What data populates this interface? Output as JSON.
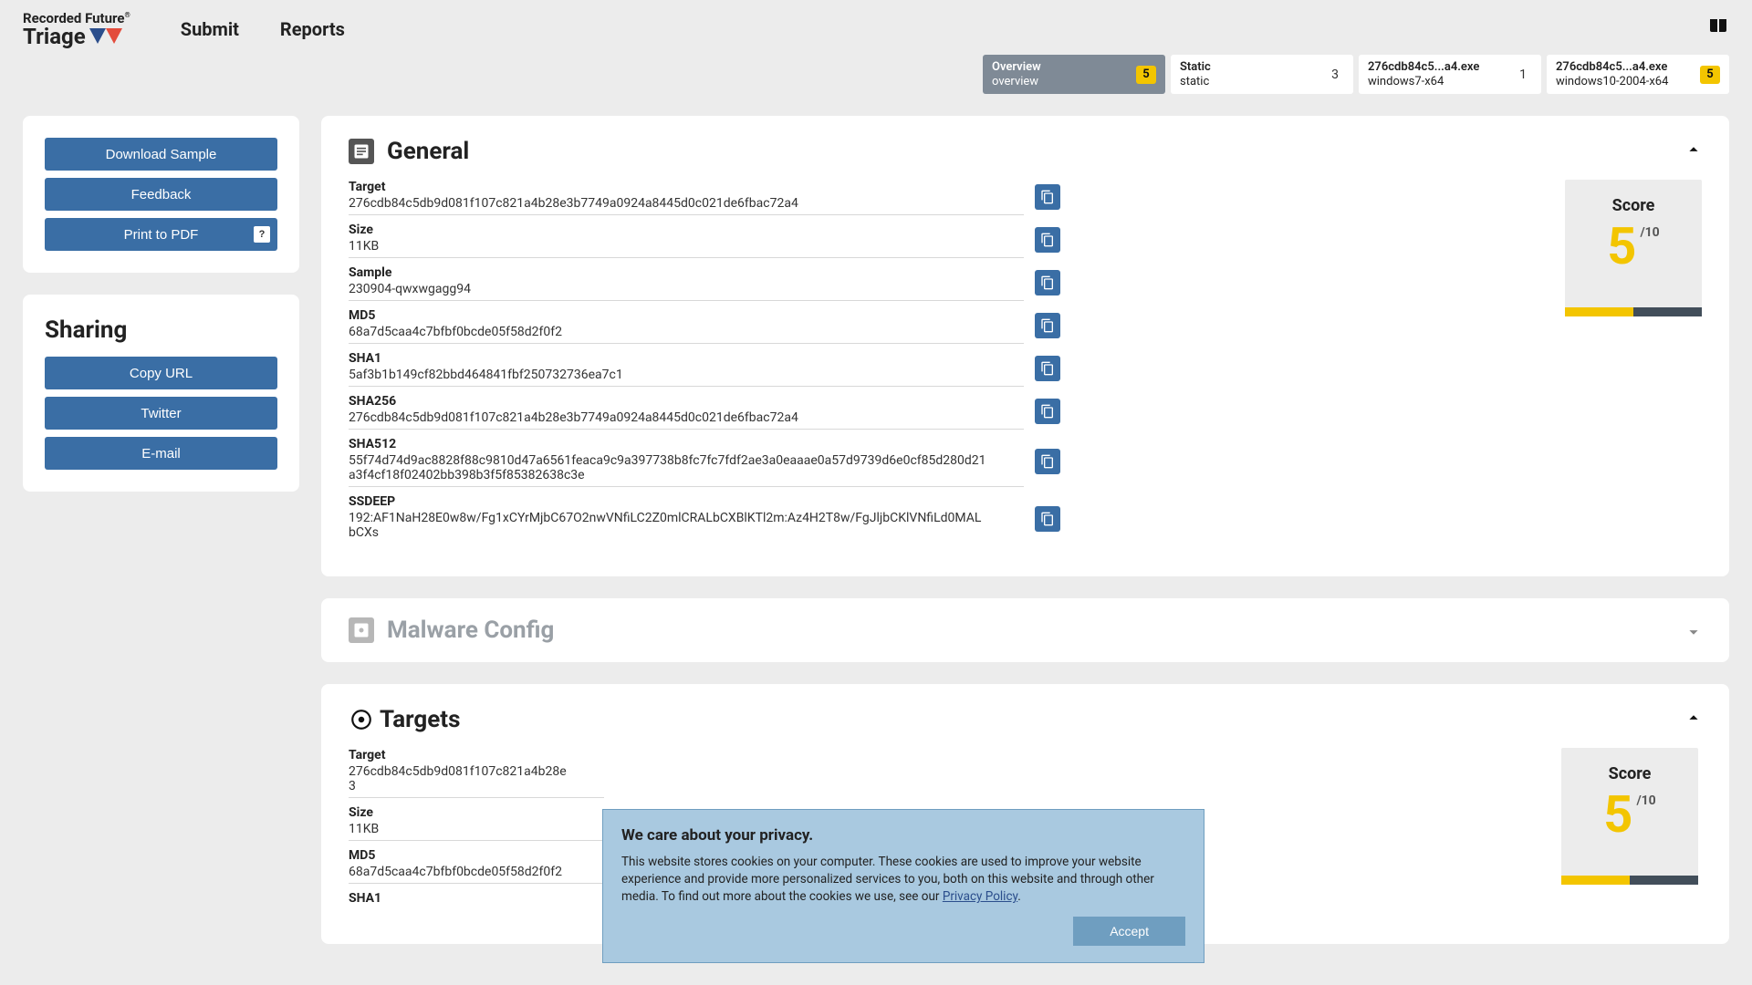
{
  "brand": {
    "line1": "Recorded Future",
    "line2": "Triage"
  },
  "nav": {
    "submit": "Submit",
    "reports": "Reports"
  },
  "tabs": [
    {
      "title": "Overview",
      "sub": "overview",
      "badge": 5,
      "badgeType": "score",
      "active": true
    },
    {
      "title": "Static",
      "sub": "static",
      "badge": 3,
      "badgeType": "plain",
      "active": false
    },
    {
      "title": "276cdb84c5...a4.exe",
      "sub": "windows7-x64",
      "badge": 1,
      "badgeType": "plain",
      "active": false
    },
    {
      "title": "276cdb84c5...a4.exe",
      "sub": "windows10-2004-x64",
      "badge": 5,
      "badgeType": "score",
      "active": false
    }
  ],
  "sidebar": {
    "download": "Download Sample",
    "feedback": "Feedback",
    "print": "Print to PDF",
    "print_key": "?",
    "sharing_title": "Sharing",
    "copy_url": "Copy URL",
    "twitter": "Twitter",
    "email": "E-mail"
  },
  "general": {
    "title": "General",
    "score_label": "Score",
    "score": "5",
    "score_max": "/10",
    "fields": {
      "target_l": "Target",
      "target": "276cdb84c5db9d081f107c821a4b28e3b7749a0924a8445d0c021de6fbac72a4",
      "size_l": "Size",
      "size": "11KB",
      "sample_l": "Sample",
      "sample": "230904-qwxwgagg94",
      "md5_l": "MD5",
      "md5": "68a7d5caa4c7bfbf0bcde05f58d2f0f2",
      "sha1_l": "SHA1",
      "sha1": "5af3b1b149cf82bbd464841fbf250732736ea7c1",
      "sha256_l": "SHA256",
      "sha256": "276cdb84c5db9d081f107c821a4b28e3b7749a0924a8445d0c021de6fbac72a4",
      "sha512_l": "SHA512",
      "sha512": "55f74d74d9ac8828f88c9810d47a6561feaca9c9a397738b8fc7fc7fdf2ae3a0eaaae0a57d9739d6e0cf85d280d21a3f4cf18f02402bb398b3f5f85382638c3e",
      "ssdeep_l": "SSDEEP",
      "ssdeep": "192:AF1NaH28E0w8w/Fg1xCYrMjbC67O2nwVNfiLC2Z0mlCRALbCXBlKTl2m:Az4H2T8w/FgJljbCKlVNfiLd0MALbCXs"
    }
  },
  "malware_config": {
    "title": "Malware Config"
  },
  "targets": {
    "title": "Targets",
    "score_label": "Score",
    "score": "5",
    "score_max": "/10",
    "fields": {
      "target_l": "Target",
      "target": "276cdb84c5db9d081f107c821a4b28e3",
      "size_l": "Size",
      "size": "11KB",
      "md5_l": "MD5",
      "md5": "68a7d5caa4c7bfbf0bcde05f58d2f0f2",
      "sha1_l": "SHA1"
    }
  },
  "cookie": {
    "title": "We care about your privacy.",
    "body_pre": "This website stores cookies on your computer. These cookies are used to improve your website experience and provide more personalized services to you, both on this website and through other media. To find out more about the cookies we use, see our ",
    "link": "Privacy Policy",
    "body_post": ".",
    "accept": "Accept"
  }
}
